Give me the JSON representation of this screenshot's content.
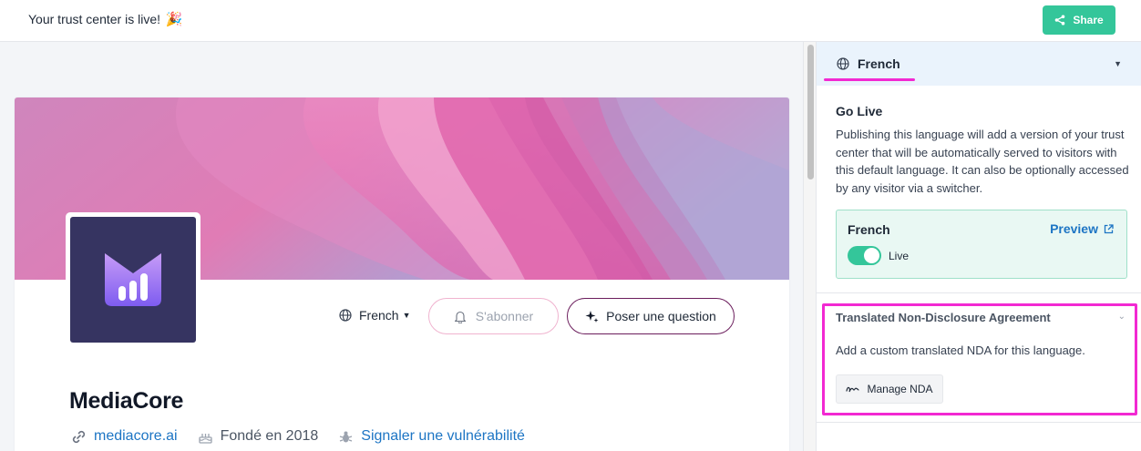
{
  "topbar": {
    "message": "Your trust center is live!",
    "emoji": "🎉",
    "share_label": "Share",
    "accent": "#34c69a"
  },
  "preview": {
    "company_name": "MediaCore",
    "language_select": "French",
    "subscribe_label": "S'abonner",
    "ask_label": "Poser une question",
    "meta": {
      "website": "mediacore.ai",
      "founded": "Fondé en 2018",
      "report": "Signaler une vulnérabilité"
    }
  },
  "panel": {
    "language": "French",
    "go_live": {
      "title": "Go Live",
      "description": "Publishing this language will add a version of your trust center that will be automatically served to visitors with this default language. It can also be optionally accessed by any visitor via a switcher."
    },
    "live_box": {
      "name": "French",
      "preview_label": "Preview",
      "status_label": "Live",
      "toggle_on": true
    },
    "nda": {
      "title": "Translated Non-Disclosure Agreement",
      "description": "Add a custom translated NDA for this language.",
      "button_label": "Manage NDA"
    }
  },
  "colors": {
    "highlight": "#f229d2",
    "link": "#1d75c4",
    "logo_bg": "#363461"
  },
  "icons": [
    "share-icon",
    "globe-icon",
    "bell-icon",
    "sparkle-icon",
    "link-icon",
    "cake-icon",
    "bug-icon",
    "external-link-icon",
    "signature-icon",
    "chevron-down-icon"
  ]
}
